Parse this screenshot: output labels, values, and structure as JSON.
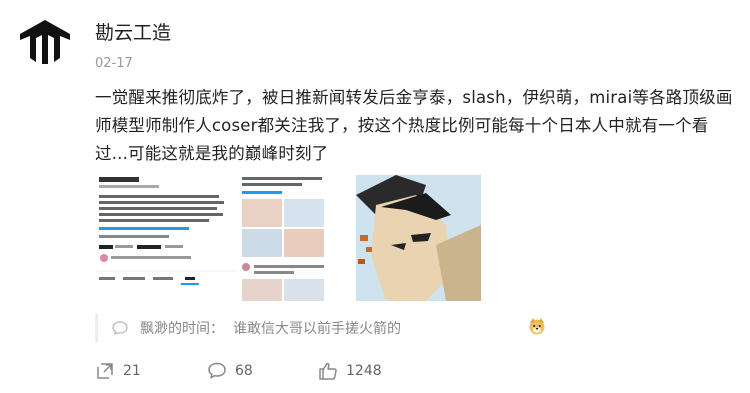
{
  "post": {
    "author": "勘云工造",
    "date": "02-17",
    "text": "一觉醒来推彻底炸了，被日推新闻转发后金亨泰，slash，伊织萌，mirai等各路顶级画师模型师制作人coser都关注我了，按这个热度比例可能每十个日本人中就有一个看过...可能这就是我的巅峰时刻了"
  },
  "images": [
    {
      "name": "twitter-profile-screenshot"
    },
    {
      "name": "twitter-timeline-screenshot"
    },
    {
      "name": "manga-illustration"
    }
  ],
  "comment": {
    "user": "飘渺的时间",
    "separator": "：",
    "text": "谁敢信大哥以前手搓火箭的",
    "emoji": "doge-emoji"
  },
  "actions": {
    "repost_count": "21",
    "comment_count": "68",
    "like_count": "1248"
  },
  "colors": {
    "text": "#222222",
    "muted": "#888888",
    "date": "#9a9a9a"
  }
}
